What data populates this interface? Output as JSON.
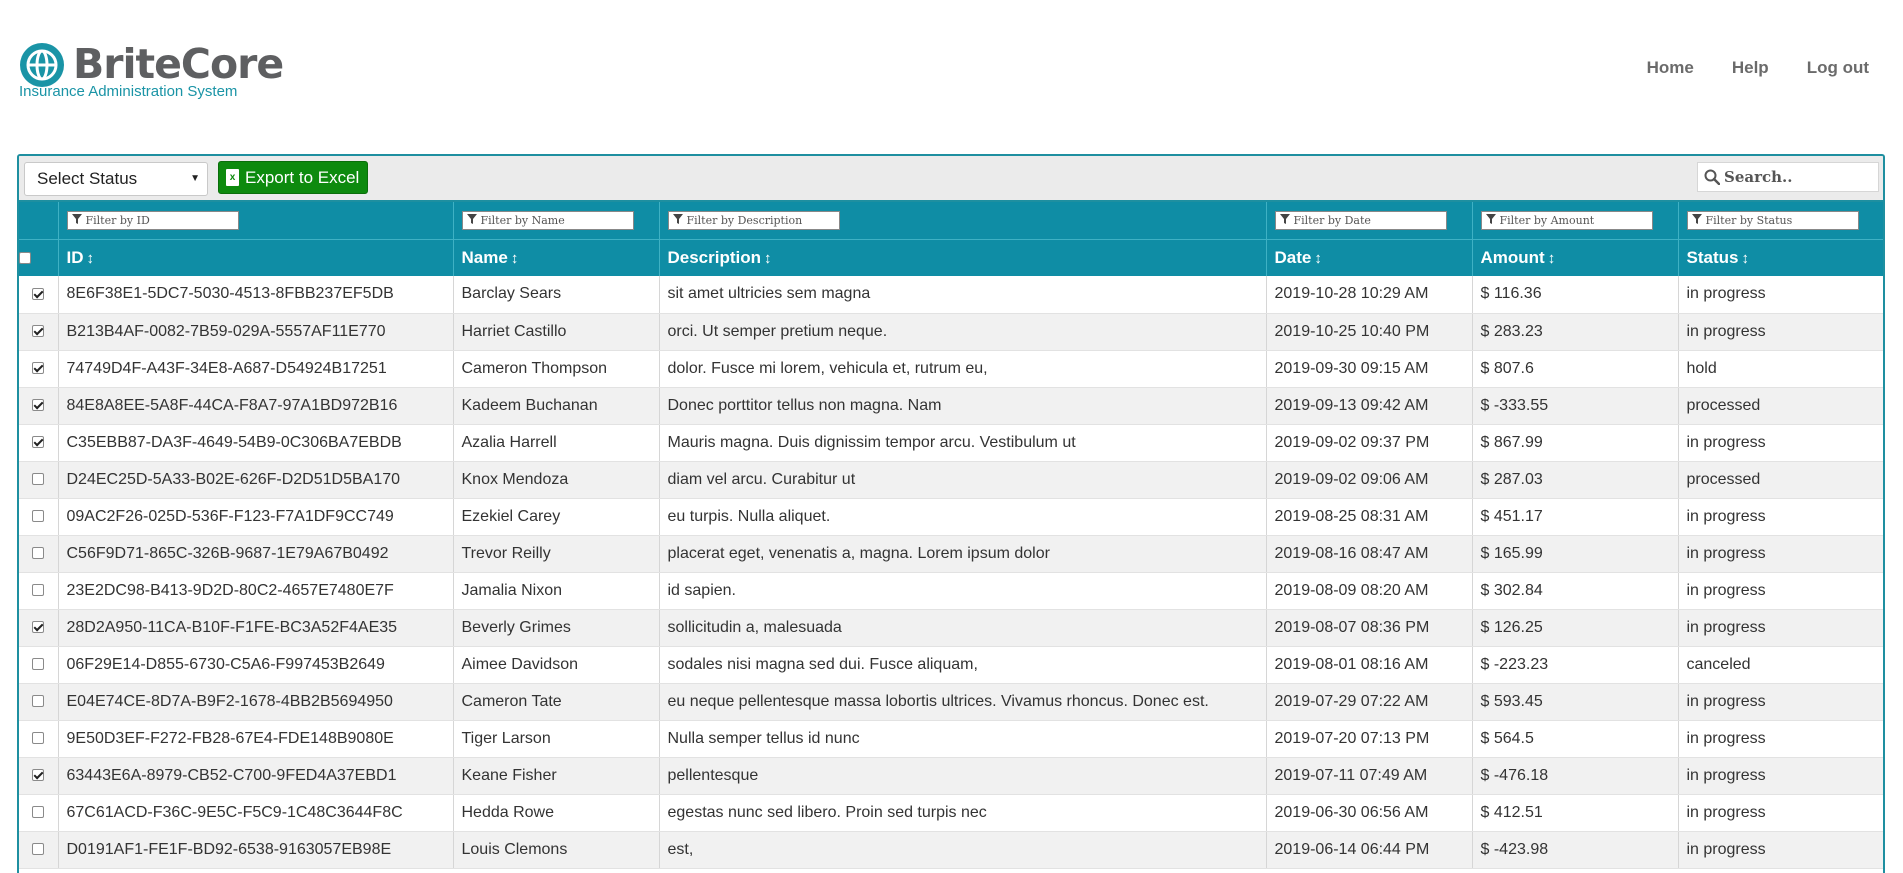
{
  "brand": {
    "name": "BriteCore",
    "tagline": "Insurance Administration System",
    "color": "#1a94a6"
  },
  "nav": {
    "items": [
      "Home",
      "Help",
      "Log out"
    ]
  },
  "toolbar": {
    "status_select": "Select Status",
    "export_label": "Export to Excel",
    "export_icon": "excel-icon",
    "search_placeholder": "Search.."
  },
  "table": {
    "filters": [
      "Filter by ID",
      "Filter by Name",
      "Filter by Description",
      "Filter by Date",
      "Filter by Amount",
      "Filter by Status"
    ],
    "columns": [
      "ID",
      "Name",
      "Description",
      "Date",
      "Amount",
      "Status"
    ],
    "header_color": "#0f8da5",
    "rows": [
      {
        "checked": true,
        "id": "8E6F38E1-5DC7-5030-4513-8FBB237EF5DB",
        "name": "Barclay Sears",
        "description": "sit amet ultricies sem magna",
        "date": "2019-10-28 10:29 AM",
        "amount": "$ 116.36",
        "status": "in progress"
      },
      {
        "checked": true,
        "id": "B213B4AF-0082-7B59-029A-5557AF11E770",
        "name": "Harriet Castillo",
        "description": "orci. Ut semper pretium neque.",
        "date": "2019-10-25 10:40 PM",
        "amount": "$ 283.23",
        "status": "in progress"
      },
      {
        "checked": true,
        "id": "74749D4F-A43F-34E8-A687-D54924B17251",
        "name": "Cameron Thompson",
        "description": "dolor. Fusce mi lorem, vehicula et, rutrum eu,",
        "date": "2019-09-30 09:15 AM",
        "amount": "$ 807.6",
        "status": "hold"
      },
      {
        "checked": true,
        "id": "84E8A8EE-5A8F-44CA-F8A7-97A1BD972B16",
        "name": "Kadeem Buchanan",
        "description": "Donec porttitor tellus non magna. Nam",
        "date": "2019-09-13 09:42 AM",
        "amount": "$ -333.55",
        "status": "processed"
      },
      {
        "checked": true,
        "id": "C35EBB87-DA3F-4649-54B9-0C306BA7EBDB",
        "name": "Azalia Harrell",
        "description": "Mauris magna. Duis dignissim tempor arcu. Vestibulum ut",
        "date": "2019-09-02 09:37 PM",
        "amount": "$ 867.99",
        "status": "in progress"
      },
      {
        "checked": false,
        "id": "D24EC25D-5A33-B02E-626F-D2D51D5BA170",
        "name": "Knox Mendoza",
        "description": "diam vel arcu. Curabitur ut",
        "date": "2019-09-02 09:06 AM",
        "amount": "$ 287.03",
        "status": "processed"
      },
      {
        "checked": false,
        "id": "09AC2F26-025D-536F-F123-F7A1DF9CC749",
        "name": "Ezekiel Carey",
        "description": "eu turpis. Nulla aliquet.",
        "date": "2019-08-25 08:31 AM",
        "amount": "$ 451.17",
        "status": "in progress"
      },
      {
        "checked": false,
        "id": "C56F9D71-865C-326B-9687-1E79A67B0492",
        "name": "Trevor Reilly",
        "description": "placerat eget, venenatis a, magna. Lorem ipsum dolor",
        "date": "2019-08-16 08:47 AM",
        "amount": "$ 165.99",
        "status": "in progress"
      },
      {
        "checked": false,
        "id": "23E2DC98-B413-9D2D-80C2-4657E7480E7F",
        "name": "Jamalia Nixon",
        "description": "id sapien.",
        "date": "2019-08-09 08:20 AM",
        "amount": "$ 302.84",
        "status": "in progress"
      },
      {
        "checked": true,
        "id": "28D2A950-11CA-B10F-F1FE-BC3A52F4AE35",
        "name": "Beverly Grimes",
        "description": "sollicitudin a, malesuada",
        "date": "2019-08-07 08:36 PM",
        "amount": "$ 126.25",
        "status": "in progress"
      },
      {
        "checked": false,
        "id": "06F29E14-D855-6730-C5A6-F997453B2649",
        "name": "Aimee Davidson",
        "description": "sodales nisi magna sed dui. Fusce aliquam,",
        "date": "2019-08-01 08:16 AM",
        "amount": "$ -223.23",
        "status": "canceled"
      },
      {
        "checked": false,
        "id": "E04E74CE-8D7A-B9F2-1678-4BB2B5694950",
        "name": "Cameron Tate",
        "description": "eu neque pellentesque massa lobortis ultrices. Vivamus rhoncus. Donec est.",
        "date": "2019-07-29 07:22 AM",
        "amount": "$ 593.45",
        "status": "in progress"
      },
      {
        "checked": false,
        "id": "9E50D3EF-F272-FB28-67E4-FDE148B9080E",
        "name": "Tiger Larson",
        "description": "Nulla semper tellus id nunc",
        "date": "2019-07-20 07:13 PM",
        "amount": "$ 564.5",
        "status": "in progress"
      },
      {
        "checked": true,
        "id": "63443E6A-8979-CB52-C700-9FED4A37EBD1",
        "name": "Keane Fisher",
        "description": "pellentesque",
        "date": "2019-07-11 07:49 AM",
        "amount": "$ -476.18",
        "status": "in progress"
      },
      {
        "checked": false,
        "id": "67C61ACD-F36C-9E5C-F5C9-1C48C3644F8C",
        "name": "Hedda Rowe",
        "description": "egestas nunc sed libero. Proin sed turpis nec",
        "date": "2019-06-30 06:56 AM",
        "amount": "$ 412.51",
        "status": "in progress"
      },
      {
        "checked": false,
        "id": "D0191AF1-FE1F-BD92-6538-9163057EB98E",
        "name": "Louis Clemons",
        "description": "est,",
        "date": "2019-06-14 06:44 PM",
        "amount": "$ -423.98",
        "status": "in progress"
      }
    ]
  }
}
